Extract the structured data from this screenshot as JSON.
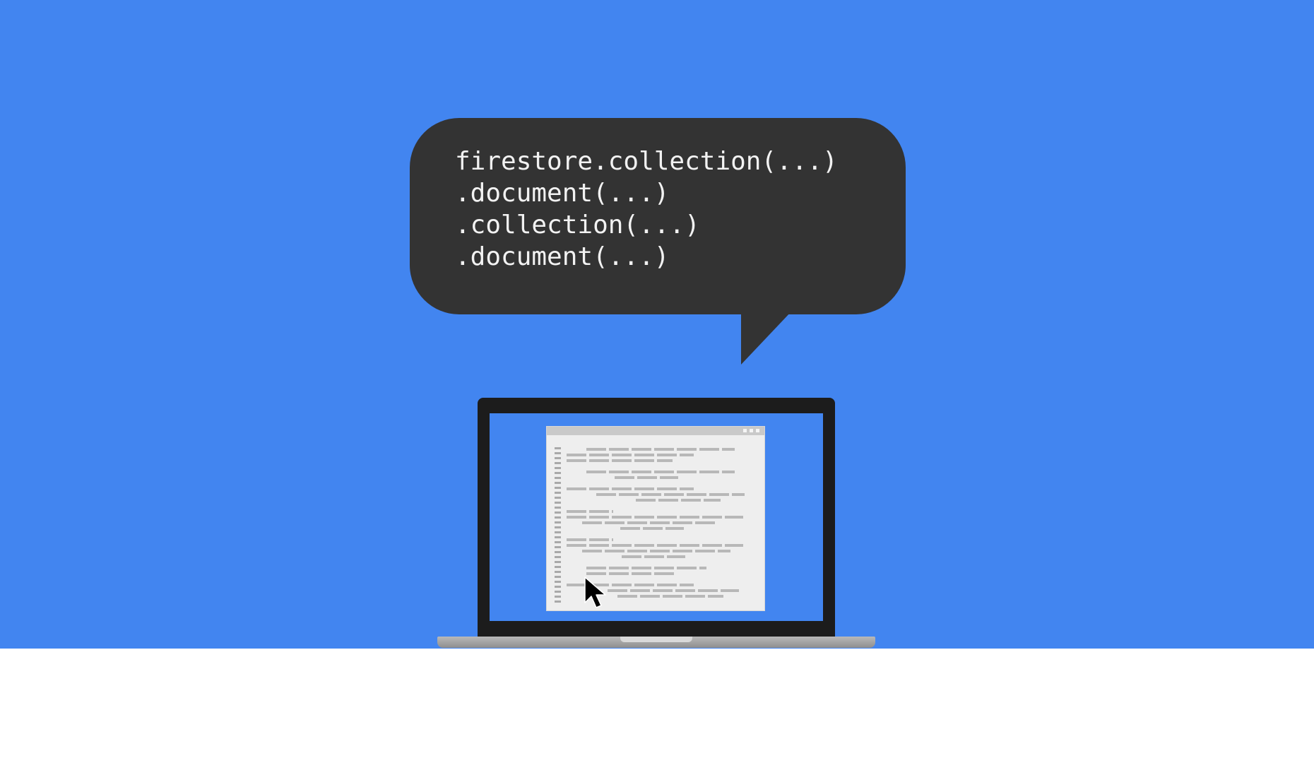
{
  "colors": {
    "background_band": "#4285f0",
    "lower_band": "#ffffff",
    "bubble": "#333333",
    "code_text": "#f2f2f2",
    "laptop_frame": "#1c1c1c",
    "document": "#eeeeee"
  },
  "speech_bubble": {
    "code_lines": [
      "firestore.collection(...)",
      ".document(...)",
      ".collection(...)",
      ".document(...)"
    ]
  },
  "laptop": {
    "screen_content": "document-window",
    "pointer_icon": "mouse-pointer-icon"
  }
}
